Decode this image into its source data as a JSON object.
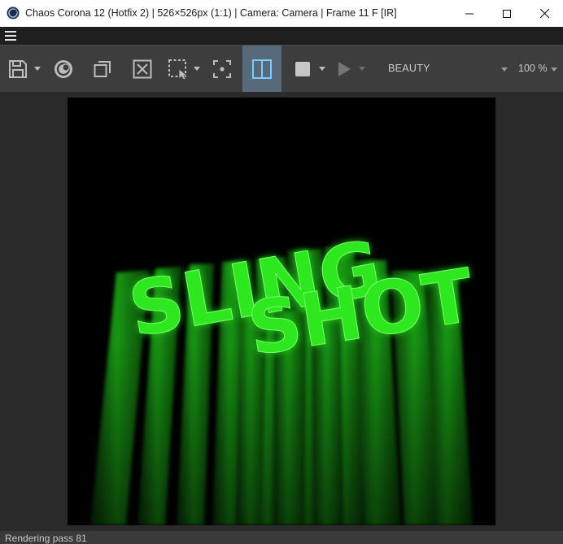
{
  "window": {
    "title": "Chaos Corona 12 (Hotfix 2) | 526×526px (1:1) | Camera: Camera | Frame 11 F [IR]",
    "controls": [
      "minimize",
      "maximize",
      "close"
    ]
  },
  "menu": {
    "icon": "hamburger-menu-icon"
  },
  "toolbar": {
    "buttons": [
      {
        "name": "save",
        "icon": "floppy-disk-icon",
        "has_dropdown": true
      },
      {
        "name": "corona-logo",
        "icon": "corona-logo-icon"
      },
      {
        "name": "copy",
        "icon": "copy-icon"
      },
      {
        "name": "clear",
        "icon": "clear-icon"
      },
      {
        "name": "region-select",
        "icon": "region-select-icon",
        "has_dropdown": true
      },
      {
        "name": "focus-pick",
        "icon": "focus-target-icon"
      },
      {
        "name": "compare",
        "icon": "split-compare-icon",
        "active": true
      },
      {
        "name": "stop",
        "icon": "stop-icon",
        "has_dropdown": true
      },
      {
        "name": "render",
        "icon": "play-icon",
        "disabled": true,
        "has_dropdown": true
      }
    ],
    "render_pass": "BEAUTY",
    "zoom": "100 %"
  },
  "render": {
    "text_line1": "SLING",
    "text_line2": "SHOT",
    "glow_color": "#2ee81f",
    "background": "#000000"
  },
  "status": {
    "text": "Rendering pass 81"
  },
  "colors": {
    "titlebar": "#ffffff",
    "toolbar": "#3d3d3d",
    "active_button": "#566a7c",
    "active_icon": "#7ecbff",
    "viewport": "#2a2a2a",
    "statusbar": "#3a3a3a"
  }
}
